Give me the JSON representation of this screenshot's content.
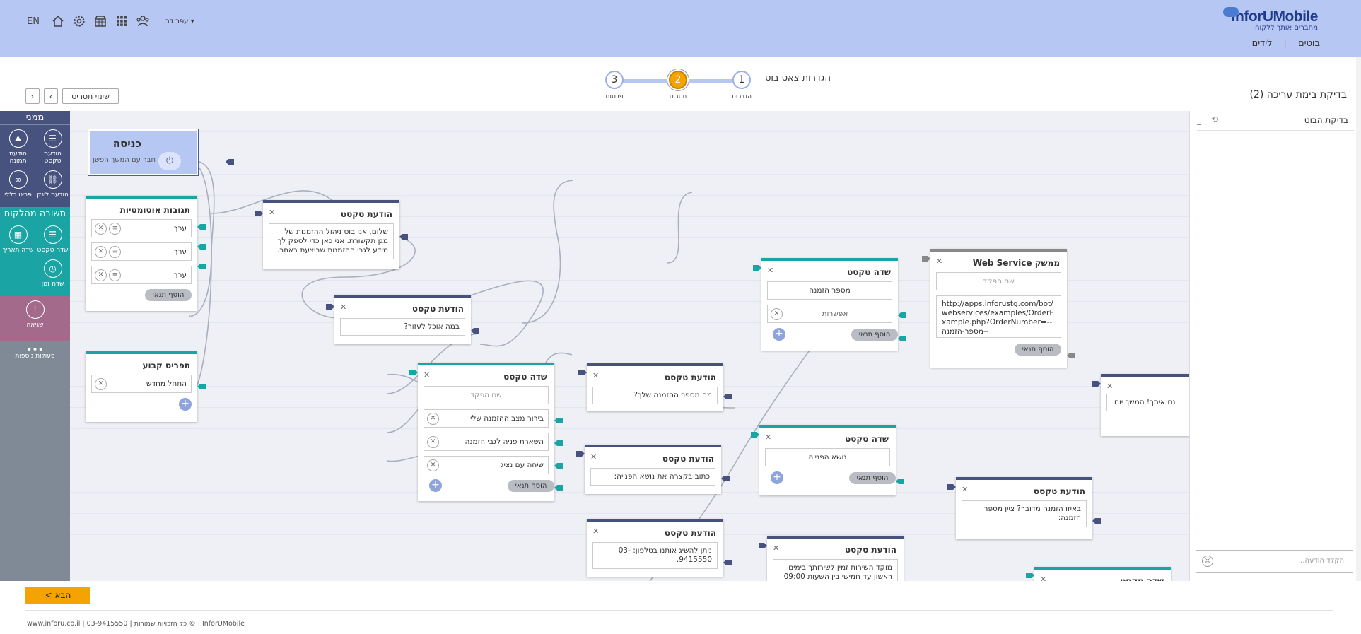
{
  "header": {
    "brand": "InforUMobile",
    "brand_slogan": "מחברים אותך ללקוח",
    "nav": [
      "בוטים",
      "לידים"
    ],
    "lang": "EN",
    "user": "עפר דר"
  },
  "page": {
    "title": "בדיקת בימת עריכה (2)",
    "settings_label": "הגדרות צאט בוט",
    "steps": [
      {
        "num": "1",
        "label": "הגדרות"
      },
      {
        "num": "2",
        "label": "תסריט"
      },
      {
        "num": "3",
        "label": "פרסום"
      }
    ],
    "change_script": "שינוי תסריט"
  },
  "palette": {
    "sections": [
      {
        "title": "ממני",
        "items": [
          {
            "label": "הודעת טקסט",
            "icon": "text-lines-icon"
          },
          {
            "label": "הודעת תמונה",
            "icon": "image-icon"
          },
          {
            "label": "הודעת לינק",
            "icon": "link-icon"
          },
          {
            "label": "פריט כללי",
            "icon": "infinity-icon"
          }
        ]
      },
      {
        "title": "תשובה מהלקוח",
        "items": [
          {
            "label": "שדה טקסט",
            "icon": "text-lines-icon"
          },
          {
            "label": "שדה תאריך",
            "icon": "calendar-icon"
          },
          {
            "label": "שדה זמן",
            "icon": "clock-icon"
          }
        ]
      }
    ],
    "error": "שגיאה",
    "more": "פעולות נוספות"
  },
  "canvas": {
    "entry": {
      "title": "כניסה",
      "subtitle": "חבר עם המשך הפשן"
    },
    "auto": {
      "title": "תגובות אוטומטיות",
      "rows": [
        "ערך",
        "ערך",
        "ערך"
      ],
      "add": "הוסף תנאי"
    },
    "fixed": {
      "title": "תפריט קבוע",
      "rows": [
        "התחל מחדש"
      ]
    },
    "msg1": {
      "title": "הודעת טקסט",
      "text": "שלום, אני בוט ניהול ההזמנות של מגן תקשורת. אני כאן כדי לספק לך מידע לגבי ההזמנות שביצעת באתר."
    },
    "msg2": {
      "title": "הודעת טקסט",
      "text": "במה אוכל לעזור?"
    },
    "field1": {
      "title": "שדה טקסט",
      "placeholder": "שם הפקד",
      "rows": [
        "בירור מצב ההזמנה שלי",
        "השארת פניה לגבי הזמנה",
        "שיחה עם נציג"
      ],
      "add": "הוסף תנאי"
    },
    "msg3": {
      "title": "הודעת טקסט",
      "text": "מה מספר ההזמנה שלך?"
    },
    "msg4": {
      "title": "הודעת טקסט",
      "text": "כתוב בקצרה את נושא הפנייה:"
    },
    "msg5": {
      "title": "הודעת טקסט",
      "text": "ניתן להשיג אותנו בטלפון: 03-9415550."
    },
    "msg6": {
      "title": "הודעת טקסט",
      "text": "מוקד השירות זמין לשירותך בימים ראשון עד חמישי בין השעות 09:00"
    },
    "field2": {
      "title": "שדה טקסט",
      "value": "מספר הזמנה",
      "option": "אפשרות",
      "add": "הוסף תנאי"
    },
    "field3": {
      "title": "שדה טקסט",
      "value": "נושא הפנייה",
      "add": "הוסף תנאי"
    },
    "ws": {
      "title": "ממשק Web Service",
      "placeholder": "שם הפקד",
      "url": "http://apps.inforustg.com/bot/webservices/examples/OrderExample.php?OrderNumber=--מספר-הזמנה--",
      "add": "הוסף תנאי"
    },
    "msg7": {
      "title": "הודעת טקסט",
      "text": "באיזו הזמנה מדובר? ציין מספר הזמנה:"
    },
    "msg8": {
      "text": "נח איתך! המשך יום"
    },
    "field4": {
      "title": "שדה טקסט"
    }
  },
  "test": {
    "title": "בדיקת הבוט",
    "input_placeholder": "הקלד הודעה..."
  },
  "footer": {
    "next": "הבא >",
    "copyright": "www.inforu.co.il | 03-9415550 | כל הזכויות שמורות © | InforUMobile"
  },
  "colors": {
    "header": "#b6c7f4",
    "navy": "#47527e",
    "teal": "#1aa5a4",
    "accent": "#f5a300"
  }
}
